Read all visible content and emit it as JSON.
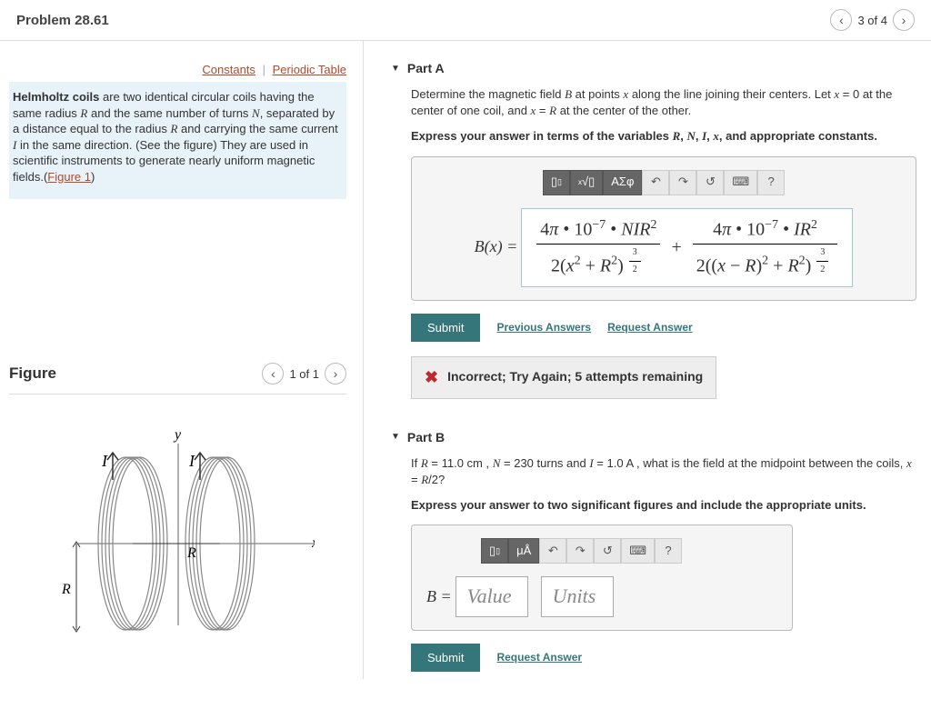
{
  "header": {
    "title": "Problem 28.61",
    "pager_text": "3 of 4"
  },
  "links": {
    "constants": "Constants",
    "periodic": "Periodic Table"
  },
  "intro": {
    "bold": "Helmholtz coils",
    "text1": " are two identical circular coils having the same radius ",
    "text2": " and the same number of turns ",
    "text3": ", separated by a distance equal to the radius ",
    "text4": " and carrying the same current ",
    "text5": " in the same direction. (See the figure) They are used in scientific instruments to generate nearly uniform magnetic fields.(",
    "figlink": "Figure 1",
    "text6": ")"
  },
  "figure": {
    "title": "Figure",
    "pager": "1 of 1",
    "y_label": "y",
    "x_label": "x",
    "r_label": "R",
    "i_label": "I"
  },
  "partA": {
    "title": "Part A",
    "desc1": "Determine the magnetic field ",
    "desc2": " at points ",
    "desc3": " along the line joining their centers. Let ",
    "desc4": " at the center of one coil, and ",
    "desc5": " at the center of the other.",
    "instr": "Express your answer in terms of the variables R, N, I, x, and appropriate constants.",
    "toolbar": {
      "greek": "ΑΣφ",
      "help": "?"
    },
    "lhs": "B(x) = ",
    "submit": "Submit",
    "prev_ans": "Previous Answers",
    "req_ans": "Request Answer",
    "feedback": "Incorrect; Try Again; 5 attempts remaining"
  },
  "partB": {
    "title": "Part B",
    "desc1": "If ",
    "desc2": " = 11.0 cm , ",
    "desc3": " = 230 turns and ",
    "desc4": " = 1.0 A , what is the field at the midpoint between the coils, ",
    "desc5": "?",
    "instr": "Express your answer to two significant figures and include the appropriate units.",
    "toolbar": {
      "units": "μÅ",
      "help": "?"
    },
    "lhs": "B = ",
    "value_ph": "Value",
    "units_ph": "Units",
    "submit": "Submit",
    "req_ans": "Request Answer"
  }
}
